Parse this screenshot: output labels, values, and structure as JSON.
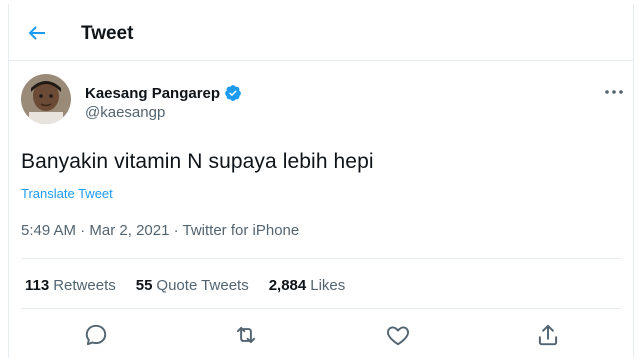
{
  "header": {
    "title": "Tweet"
  },
  "user": {
    "name": "Kaesang Pangarep",
    "handle": "@kaesangp"
  },
  "tweet": {
    "text": "Banyakin vitamin N supaya lebih hepi",
    "translate_label": "Translate Tweet",
    "time": "5:49 AM",
    "date": "Mar 2, 2021",
    "source": "Twitter for iPhone"
  },
  "stats": {
    "retweets_count": "113",
    "retweets_label": "Retweets",
    "quotes_count": "55",
    "quotes_label": "Quote Tweets",
    "likes_count": "2,884",
    "likes_label": "Likes"
  },
  "icons": {
    "back": "back-arrow-icon",
    "verified": "verified-badge-icon",
    "more": "more-icon",
    "reply": "reply-icon",
    "retweet": "retweet-icon",
    "like": "like-icon",
    "share": "share-icon"
  },
  "colors": {
    "accent": "#1d9bf0",
    "text": "#0f1419",
    "secondary": "#536471"
  }
}
